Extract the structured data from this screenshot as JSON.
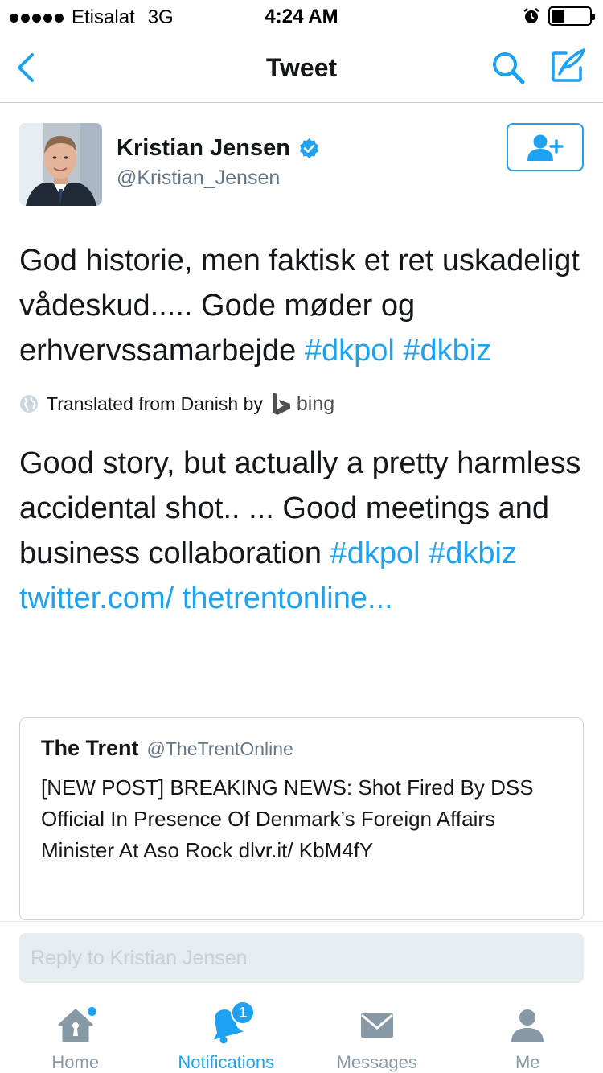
{
  "status_bar": {
    "carrier": "Etisalat",
    "network": "3G",
    "time": "4:24 AM"
  },
  "nav": {
    "title": "Tweet"
  },
  "tweet": {
    "author_name": "Kristian Jensen",
    "author_handle": "@Kristian_Jensen",
    "text_plain": "God historie, men faktisk et ret uskadeligt vådeskud.....  Gode møder og erhvervssamarbejde",
    "hashtags": [
      "#dkpol",
      "#dkbiz"
    ],
    "translated_label": "Translated from Danish by",
    "translator": "bing",
    "translation_plain": "Good story, but actually a pretty harmless accidental shot.. ...  Good meetings and business collaboration",
    "translation_hashtags": [
      "#dkpol",
      "#dkbiz"
    ],
    "translation_link": "twitter.com/ thetrentonline..."
  },
  "quoted_tweet": {
    "name": "The Trent",
    "handle": "@TheTrentOnline",
    "text": "[NEW POST] BREAKING NEWS: Shot Fired By DSS Official In Presence Of Denmark’s Foreign Affairs Minister At Aso Rock dlvr.it/ KbM4fY"
  },
  "reply": {
    "placeholder": "Reply to Kristian Jensen"
  },
  "tabs": [
    {
      "label": "Home",
      "icon": "home-icon",
      "active": false
    },
    {
      "label": "Notifications",
      "icon": "bell-icon",
      "active": true,
      "badge": "1"
    },
    {
      "label": "Messages",
      "icon": "envelope-icon",
      "active": false
    },
    {
      "label": "Me",
      "icon": "person-icon",
      "active": false
    }
  ],
  "colors": {
    "accent": "#1da1f2",
    "text": "#14171a",
    "secondary": "#657786",
    "tab_inactive": "#8899a6"
  }
}
